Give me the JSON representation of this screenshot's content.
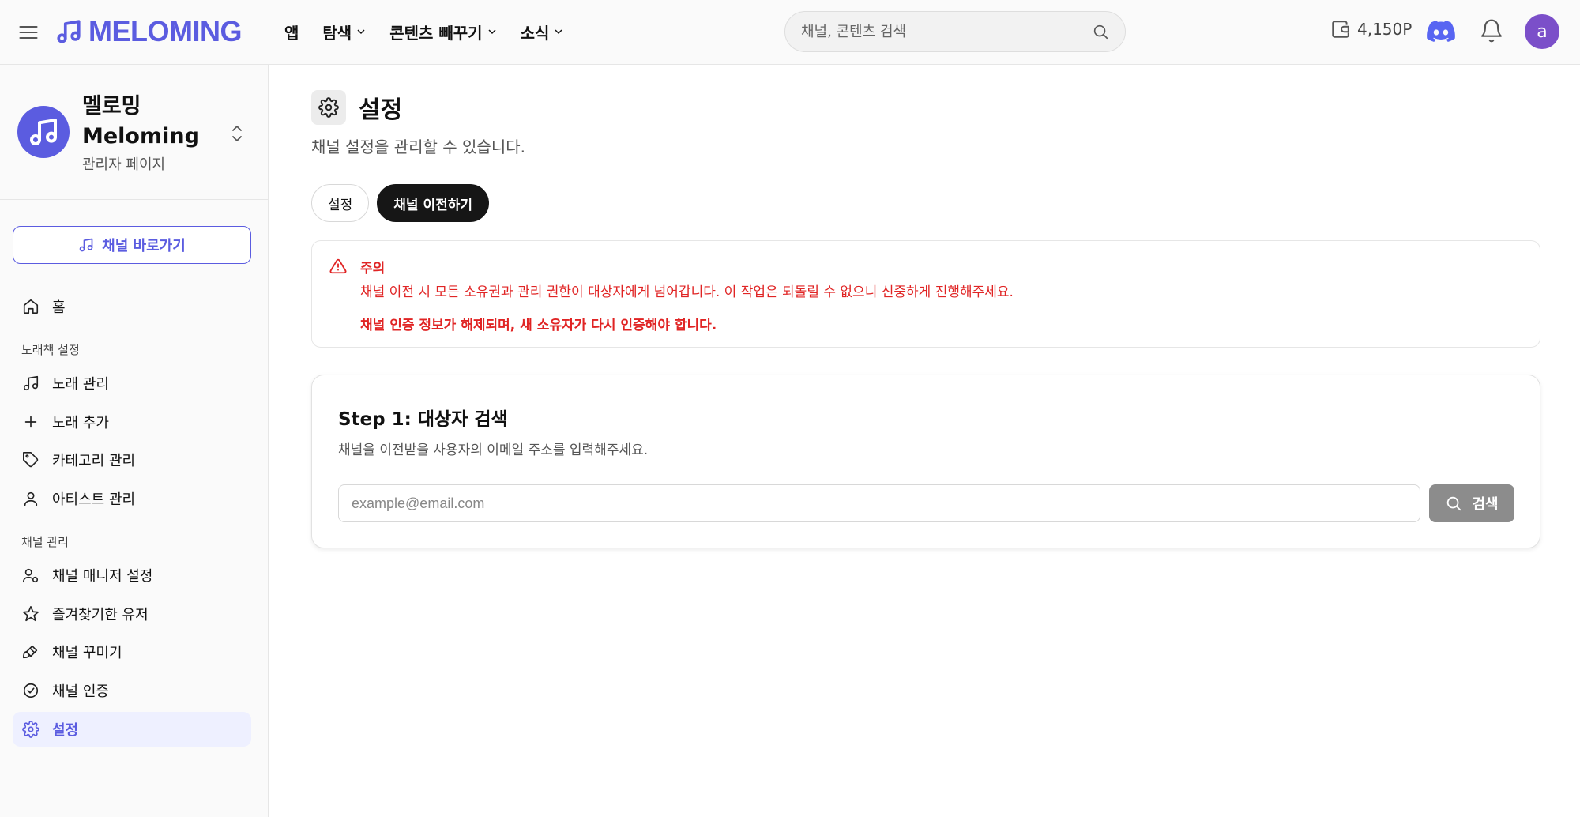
{
  "header": {
    "logo_text": "MELOMING",
    "nav": [
      {
        "label": "앱",
        "has_dropdown": false
      },
      {
        "label": "탐색",
        "has_dropdown": true
      },
      {
        "label": "콘텐츠 빼꾸기",
        "has_dropdown": true
      },
      {
        "label": "소식",
        "has_dropdown": true
      }
    ],
    "search_placeholder": "채널, 콘텐츠 검색",
    "points": "4,150P",
    "avatar_initial": "a"
  },
  "sidebar": {
    "channel_name_ko": "멜로밍",
    "channel_name_en": "Meloming",
    "channel_sub": "관리자 페이지",
    "goto_button": "채널 바로가기",
    "home": "홈",
    "section_songbook": "노래책 설정",
    "songbook_items": [
      "노래 관리",
      "노래 추가",
      "카테고리 관리",
      "아티스트 관리"
    ],
    "section_channel": "채널 관리",
    "channel_items": [
      "채널 매니저 설정",
      "즐겨찾기한 유저",
      "채널 꾸미기",
      "채널 인증",
      "설정"
    ],
    "active_item": "설정"
  },
  "main": {
    "title": "설정",
    "description": "채널 설정을 관리할 수 있습니다.",
    "tabs": [
      {
        "label": "설정",
        "active": false
      },
      {
        "label": "채널 이전하기",
        "active": true
      }
    ],
    "warning": {
      "title": "주의",
      "line1": "채널 이전 시 모든 소유권과 관리 권한이 대상자에게 넘어갑니다. 이 작업은 되돌릴 수 없으니 신중하게 진행해주세요.",
      "line2": "채널 인증 정보가 해제되며, 새 소유자가 다시 인증해야 합니다."
    },
    "step1": {
      "title": "Step 1: 대상자 검색",
      "description": "채널을 이전받을 사용자의 이메일 주소를 입력해주세요.",
      "email_placeholder": "example@email.com",
      "search_button": "검색"
    }
  },
  "colors": {
    "brand": "#5b5ce0",
    "warning": "#e02424",
    "active_bg": "#eef0ff",
    "avatar": "#7b4fc9"
  }
}
